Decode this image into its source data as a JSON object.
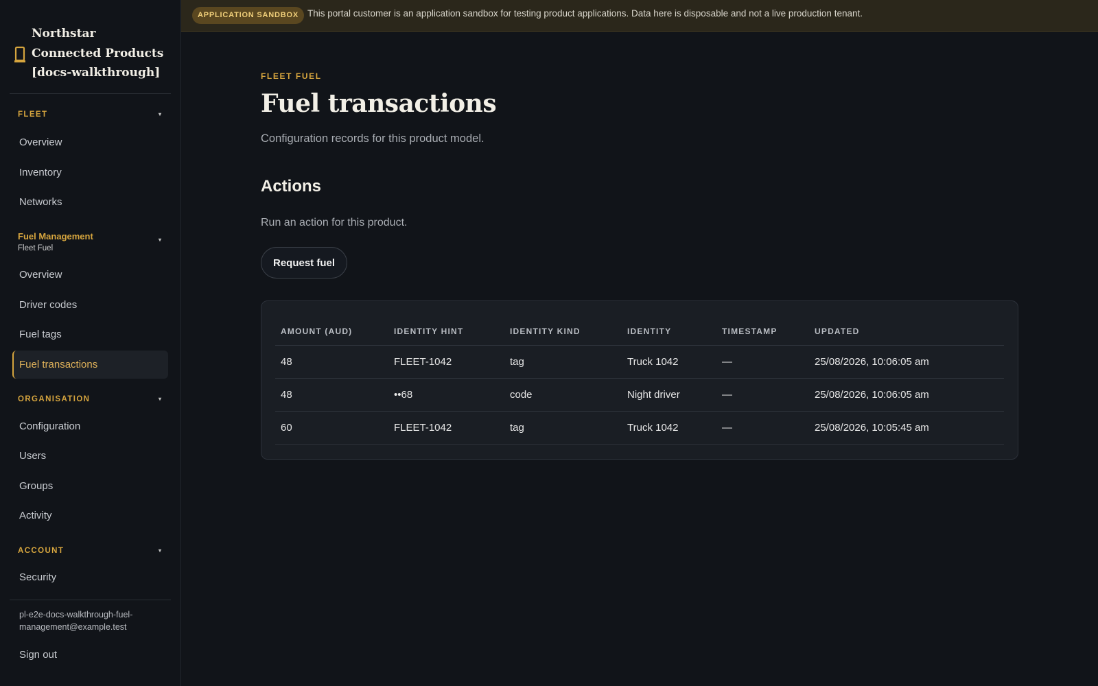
{
  "app": {
    "name": "Northstar Connected Products [docs-walkthrough]",
    "accent": "#d6a53e"
  },
  "banner": {
    "badge": "APPLICATION SANDBOX",
    "text": "This portal customer is an application sandbox for testing product applications. Data here is disposable and not a live production tenant."
  },
  "sidebar": {
    "sections": {
      "fleet": {
        "label": "FLEET",
        "items": [
          "Overview",
          "Inventory",
          "Networks"
        ]
      },
      "fuel": {
        "label": "Fuel Management",
        "sublabel": "Fleet Fuel",
        "items": [
          "Overview",
          "Driver codes",
          "Fuel tags",
          "Fuel transactions"
        ],
        "active": "Fuel transactions"
      },
      "organisation": {
        "label": "ORGANISATION",
        "items": [
          "Configuration",
          "Users",
          "Groups",
          "Activity"
        ]
      },
      "account": {
        "label": "ACCOUNT",
        "items": [
          "Security"
        ]
      }
    },
    "caret": "▾",
    "user_email": "pl-e2e-docs-walkthrough-fuel-management@example.test",
    "sign_out": "Sign out"
  },
  "main": {
    "eyebrow": "FLEET FUEL",
    "title": "Fuel transactions",
    "subtitle": "Configuration records for this product model.",
    "actions_title": "Actions",
    "actions_desc": "Run an action for this product.",
    "action_button": "Request fuel"
  },
  "table": {
    "columns": [
      "AMOUNT (AUD)",
      "IDENTITY HINT",
      "IDENTITY KIND",
      "IDENTITY",
      "TIMESTAMP",
      "UPDATED"
    ],
    "rows": [
      [
        "48",
        "FLEET-1042",
        "tag",
        "Truck 1042",
        "—",
        "25/08/2026, 10:06:05 am"
      ],
      [
        "48",
        "••68",
        "code",
        "Night driver",
        "—",
        "25/08/2026, 10:06:05 am"
      ],
      [
        "60",
        "FLEET-1042",
        "tag",
        "Truck 1042",
        "—",
        "25/08/2026, 10:05:45 am"
      ]
    ]
  }
}
